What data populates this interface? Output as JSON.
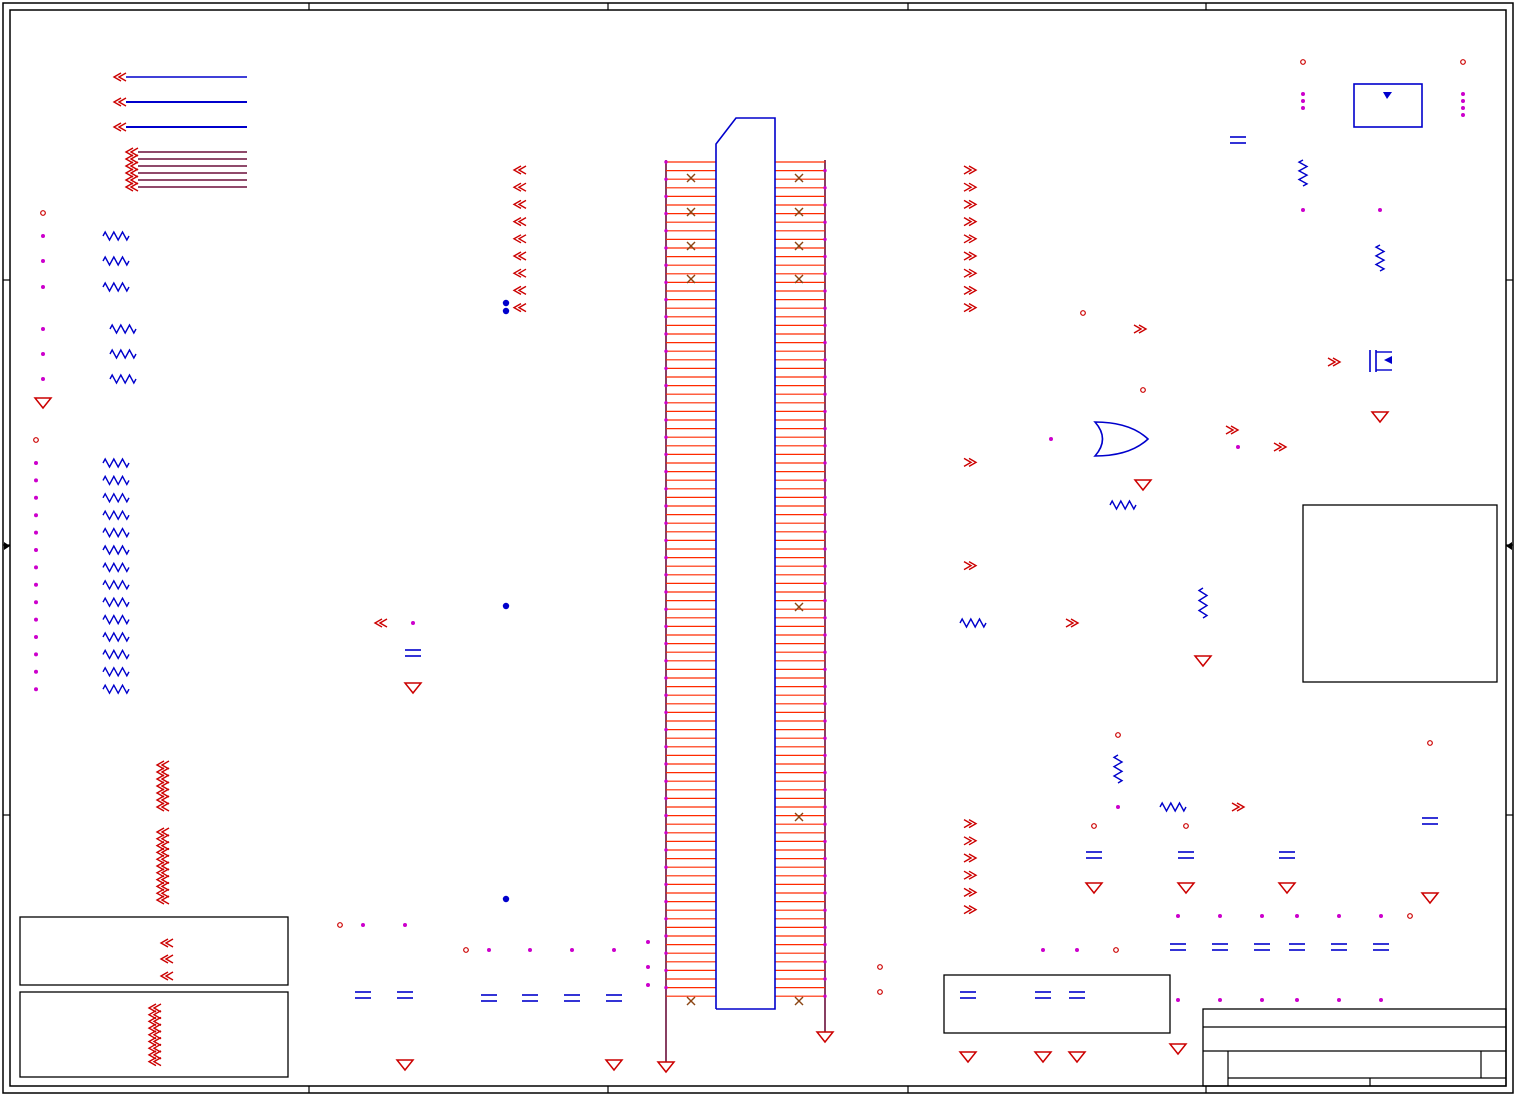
{
  "sheet": {
    "title": "",
    "colors": {
      "frame": "#000000",
      "wire": "#6b0f3a",
      "bus": "#0000cc",
      "component": "#0000cc",
      "net_flag": "#cc0000",
      "junction": "#cc00cc",
      "pin": "#ff2a00",
      "no_connect": "#8b4513",
      "connector_body": "#0000cc"
    }
  },
  "diagram": {
    "connector": {
      "left_pins": 49,
      "right_pins": 49
    },
    "components": [
      "resistor-array-a",
      "resistor-array-b",
      "resistor-array-c",
      "decoupling-capacitors",
      "or-gate",
      "mosfet-switch",
      "power-switch-ic",
      "note-box",
      "title-block"
    ]
  }
}
